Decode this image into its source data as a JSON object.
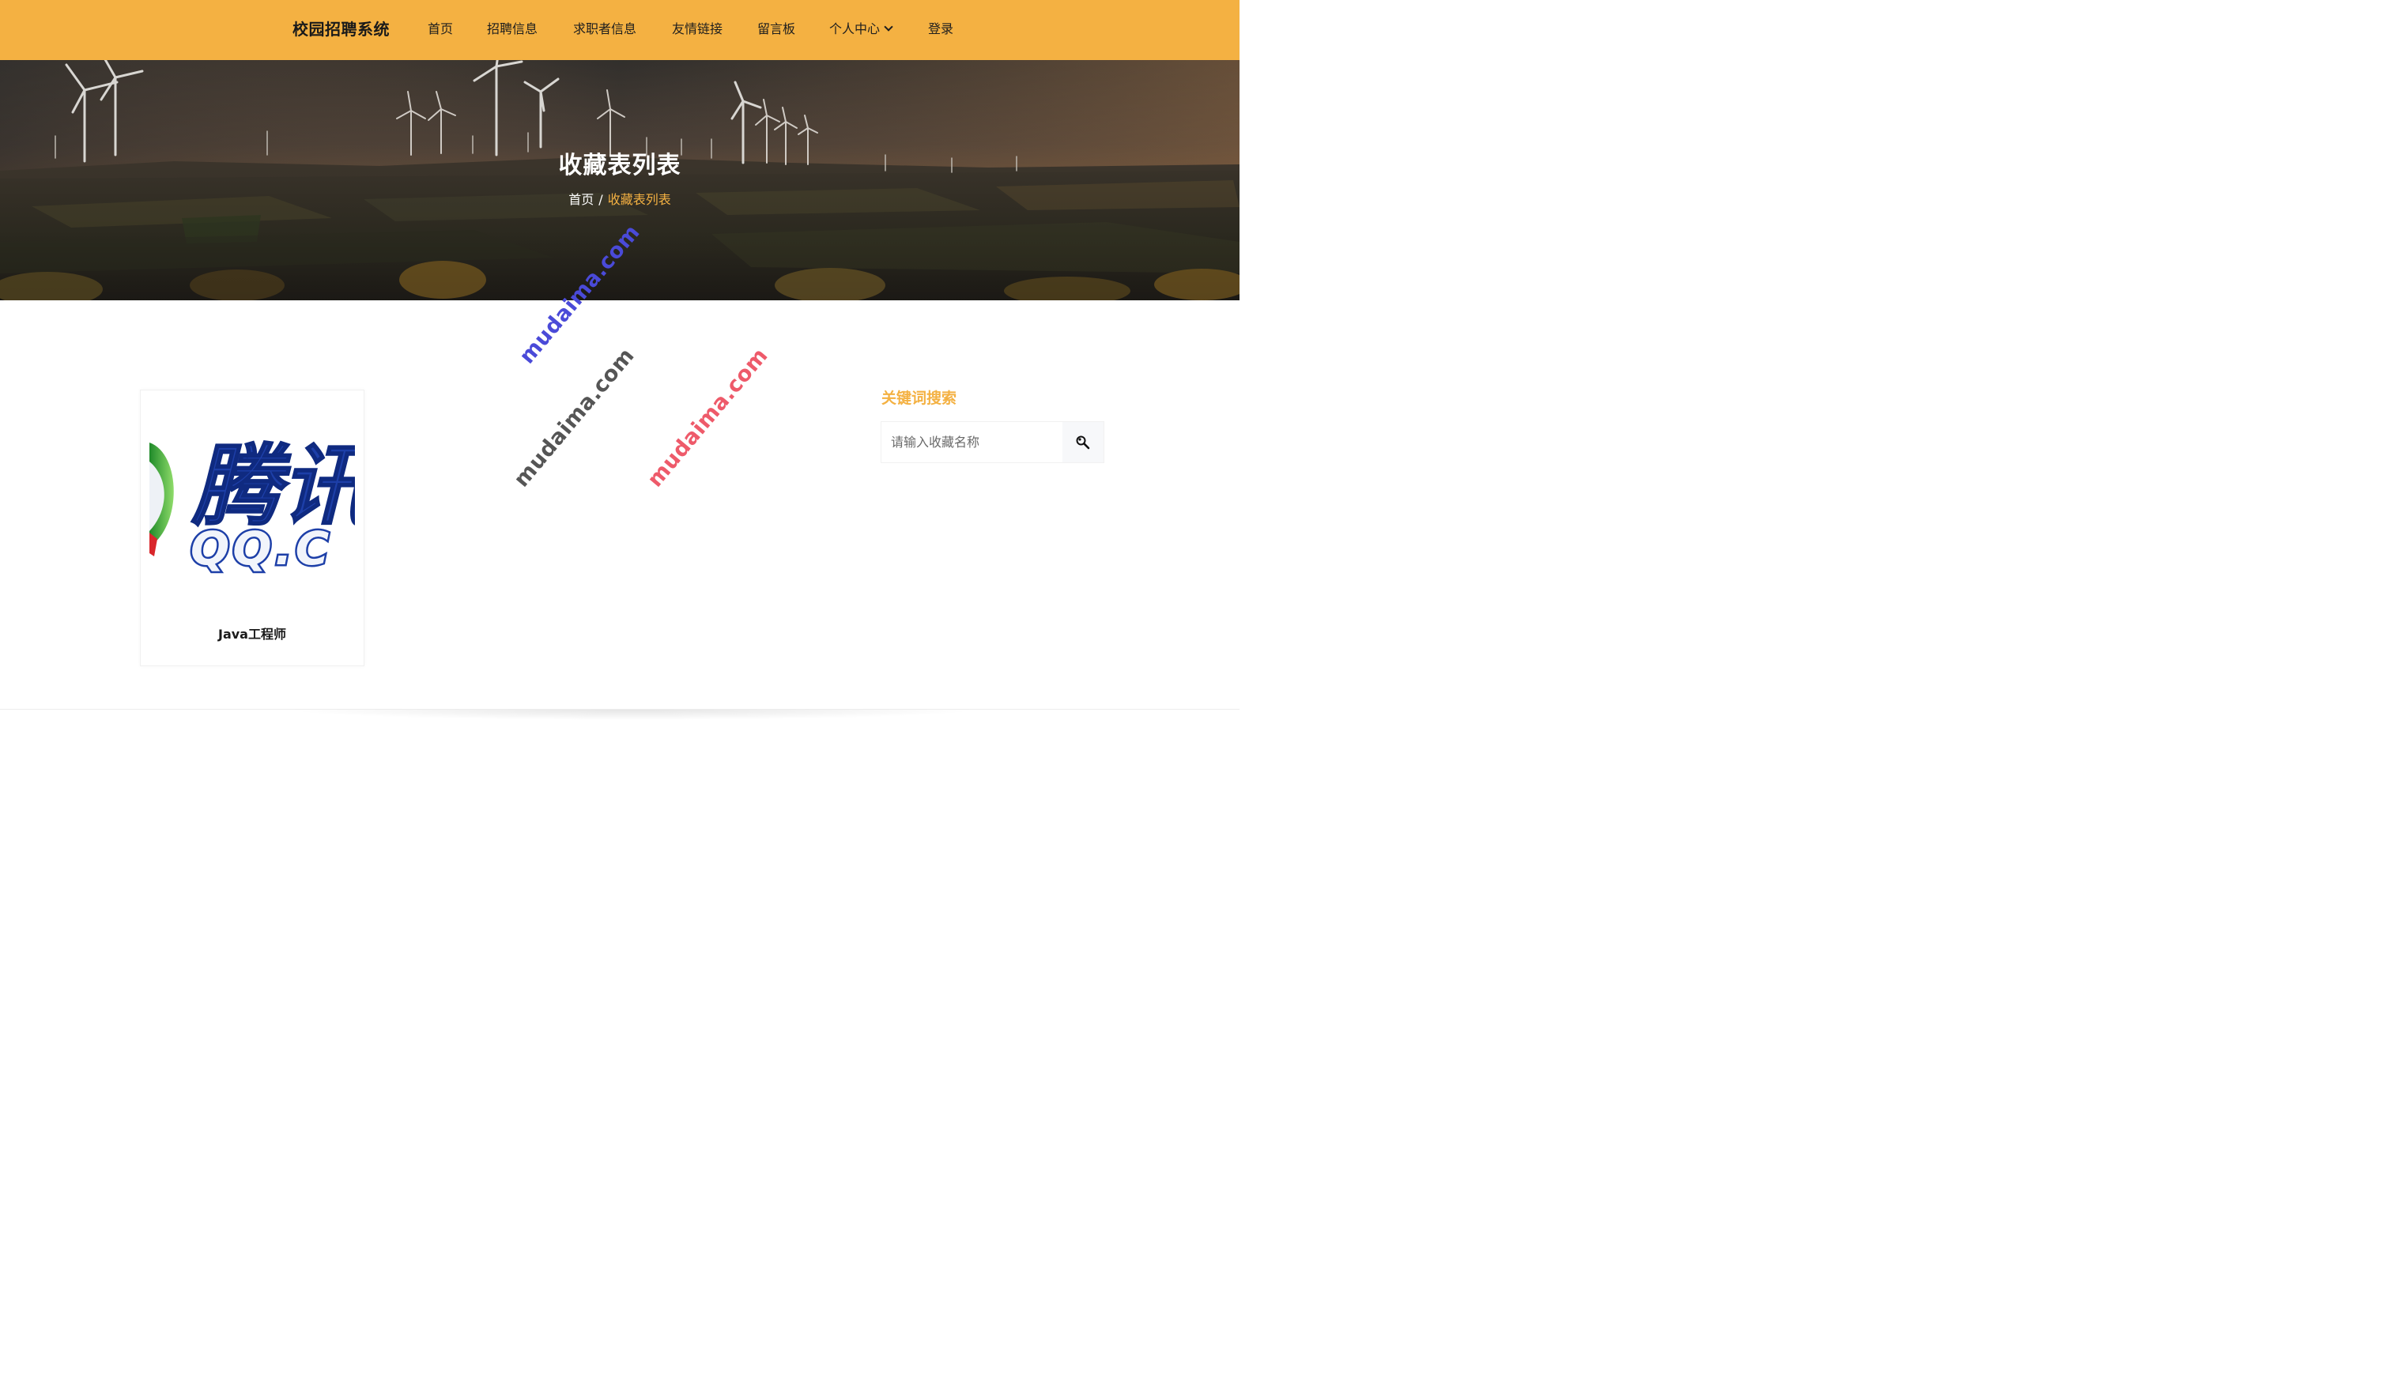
{
  "navbar": {
    "brand": "校园招聘系统",
    "items": [
      {
        "label": "首页"
      },
      {
        "label": "招聘信息"
      },
      {
        "label": "求职者信息"
      },
      {
        "label": "友情链接"
      },
      {
        "label": "留言板"
      },
      {
        "label": "个人中心",
        "has_dropdown": true
      },
      {
        "label": "登录"
      }
    ],
    "bg_color": "#f4b142"
  },
  "hero": {
    "title": "收藏表列表",
    "breadcrumb": {
      "home": "首页",
      "separator": "/",
      "current": "收藏表列表"
    }
  },
  "watermarks": [
    "mudaima.com",
    "mudaima.com",
    "mudaima.com"
  ],
  "favorites": [
    {
      "title": "Java工程师",
      "image_text": "腾讯",
      "image_subtext": "QQ.C"
    }
  ],
  "sidebar": {
    "search_title": "关键词搜索",
    "search_placeholder": "请输入收藏名称",
    "search_icon": "search-icon"
  },
  "colors": {
    "accent": "#f4b142",
    "watermark_blue": "#4a4ad8",
    "watermark_gray": "#555555",
    "watermark_red": "#ee5a6a"
  }
}
